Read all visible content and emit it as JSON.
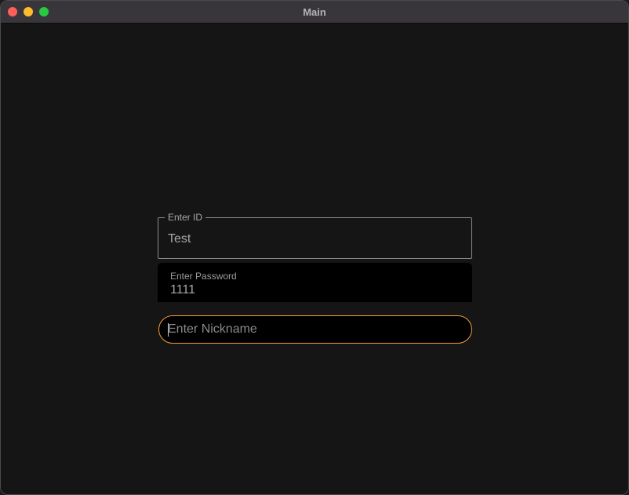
{
  "window": {
    "title": "Main",
    "controls": {
      "close_color": "#fe5f57",
      "minimize_color": "#febc2e",
      "maximize_color": "#28c840"
    }
  },
  "form": {
    "id_field": {
      "label": "Enter ID",
      "value": "Test"
    },
    "password_field": {
      "label": "Enter Password",
      "value": "1111"
    },
    "nickname_field": {
      "placeholder": "Enter Nickname",
      "value": "",
      "focus_color": "#f59e3b"
    }
  }
}
